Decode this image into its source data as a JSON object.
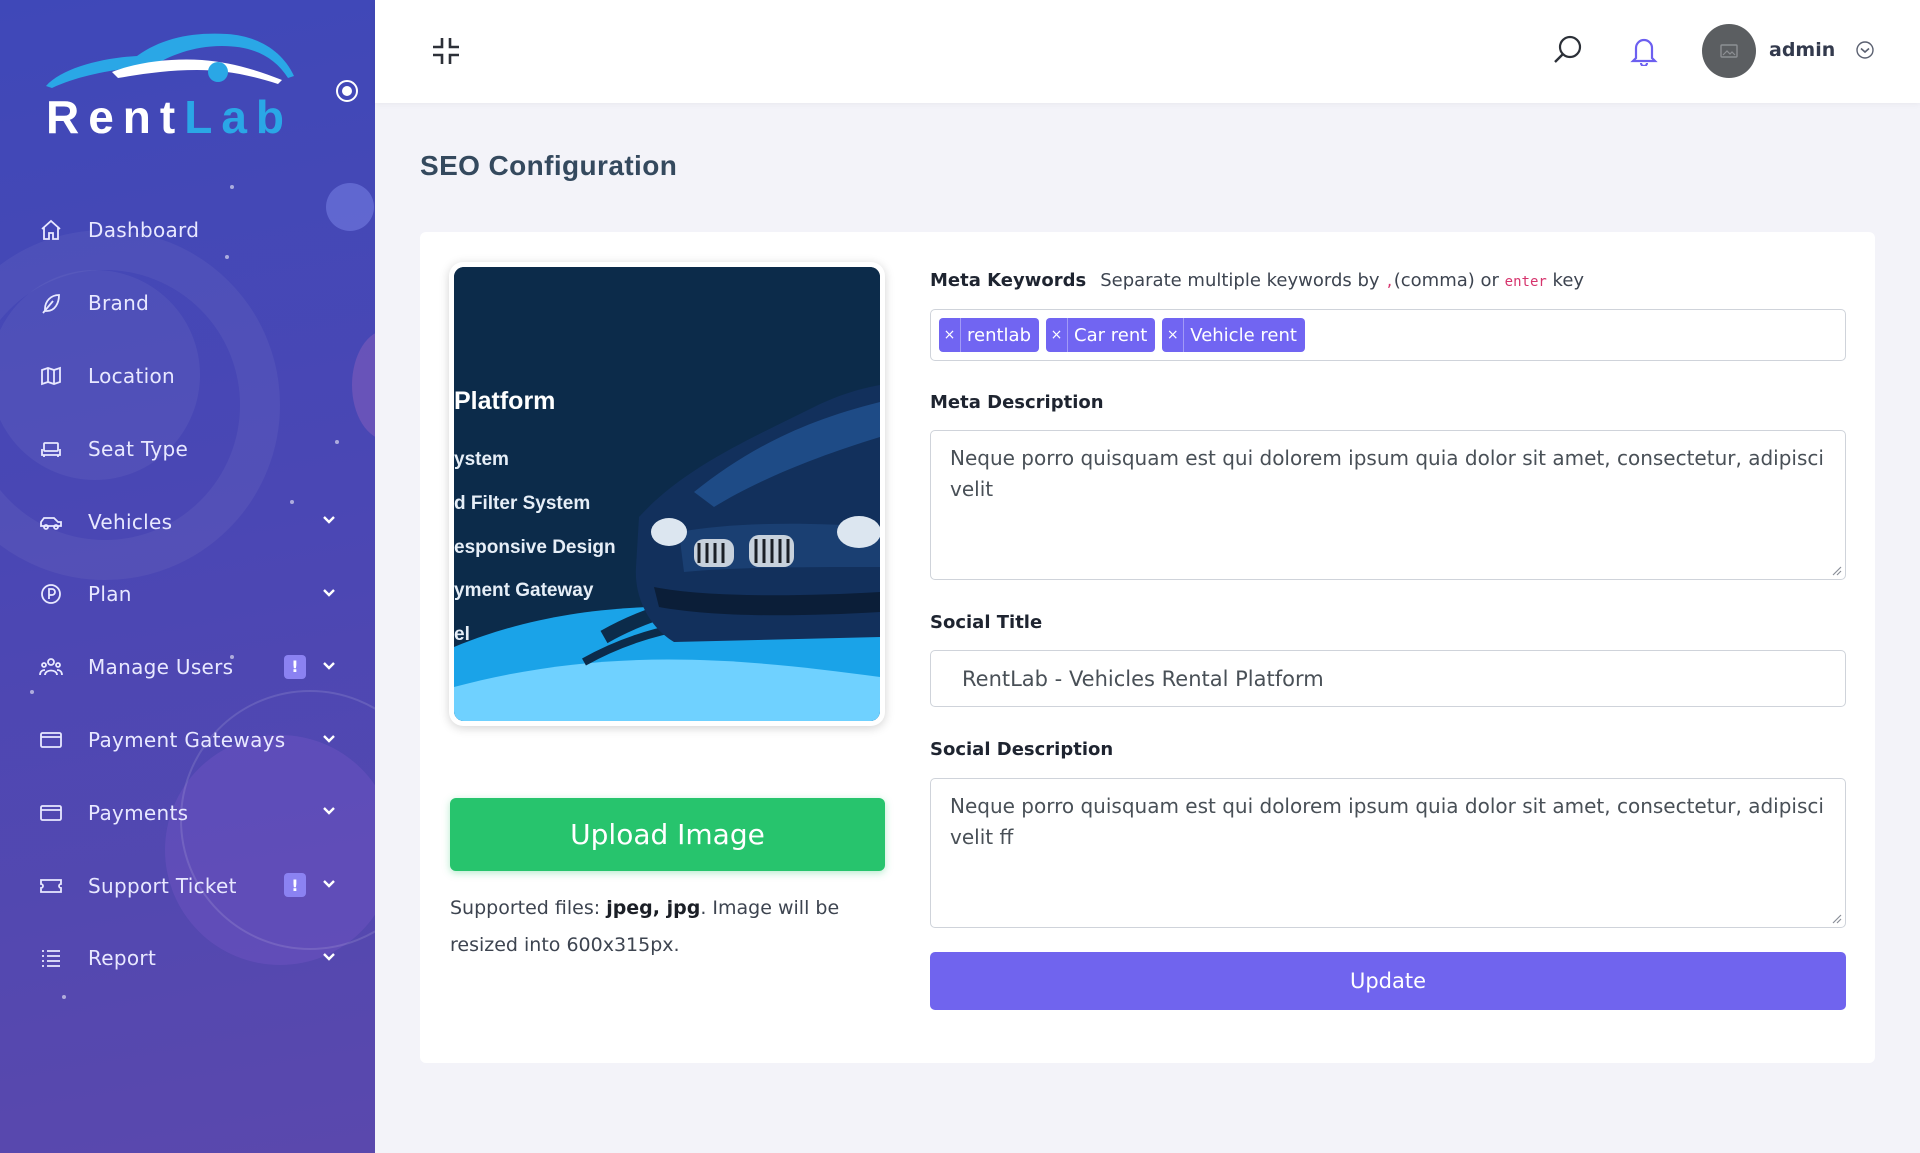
{
  "brand": {
    "name_part1": "Rent",
    "name_part2": "Lab"
  },
  "colors": {
    "sidebar": "#4a47b4",
    "accent": "#7064ee",
    "success": "#27c46d",
    "tag": "#7165f2",
    "alert_badge": "#8b82f2"
  },
  "sidebar": {
    "items": [
      {
        "label": "Dashboard",
        "icon": "home-icon"
      },
      {
        "label": "Brand",
        "icon": "feather-icon"
      },
      {
        "label": "Location",
        "icon": "map-icon"
      },
      {
        "label": "Seat Type",
        "icon": "seat-icon"
      },
      {
        "label": "Vehicles",
        "icon": "car-icon",
        "expandable": true
      },
      {
        "label": "Plan",
        "icon": "plan-icon",
        "expandable": true
      },
      {
        "label": "Manage Users",
        "icon": "users-icon",
        "expandable": true,
        "alert": "!"
      },
      {
        "label": "Payment Gateways",
        "icon": "card-icon",
        "expandable": true
      },
      {
        "label": "Payments",
        "icon": "card-icon",
        "expandable": true
      },
      {
        "label": "Support Ticket",
        "icon": "ticket-icon",
        "expandable": true,
        "alert": "!"
      },
      {
        "label": "Report",
        "icon": "list-icon",
        "expandable": true
      }
    ]
  },
  "topbar": {
    "username": "admin"
  },
  "page": {
    "title": "SEO Configuration"
  },
  "image_panel": {
    "preview_headline": "Platform",
    "preview_features": [
      "ystem",
      "d Filter System",
      "esponsive Design",
      "yment Gateway",
      "el"
    ],
    "upload_label": "Upload Image",
    "supported_prefix": "Supported files: ",
    "supported_types": "jpeg, jpg",
    "supported_suffix": ". Image will be resized into 600x315px."
  },
  "form": {
    "meta_keywords_label": "Meta Keywords",
    "meta_keywords_hint_prefix": "Separate multiple keywords by ",
    "meta_keywords_hint_code1": ",",
    "meta_keywords_hint_mid": "(comma) or ",
    "meta_keywords_hint_code2": "enter",
    "meta_keywords_hint_suffix": " key",
    "keywords": [
      "rentlab",
      "Car rent",
      "Vehicle rent"
    ],
    "tag_remove_glyph": "×",
    "meta_description_label": "Meta Description",
    "meta_description_value": "Neque porro quisquam est qui dolorem ipsum quia dolor sit amet, consectetur, adipisci velit",
    "social_title_label": "Social Title",
    "social_title_value": "RentLab - Vehicles Rental Platform",
    "social_description_label": "Social Description",
    "social_description_value": "Neque porro quisquam est qui dolorem ipsum quia dolor sit amet, consectetur, adipisci velit ff",
    "update_label": "Update"
  }
}
